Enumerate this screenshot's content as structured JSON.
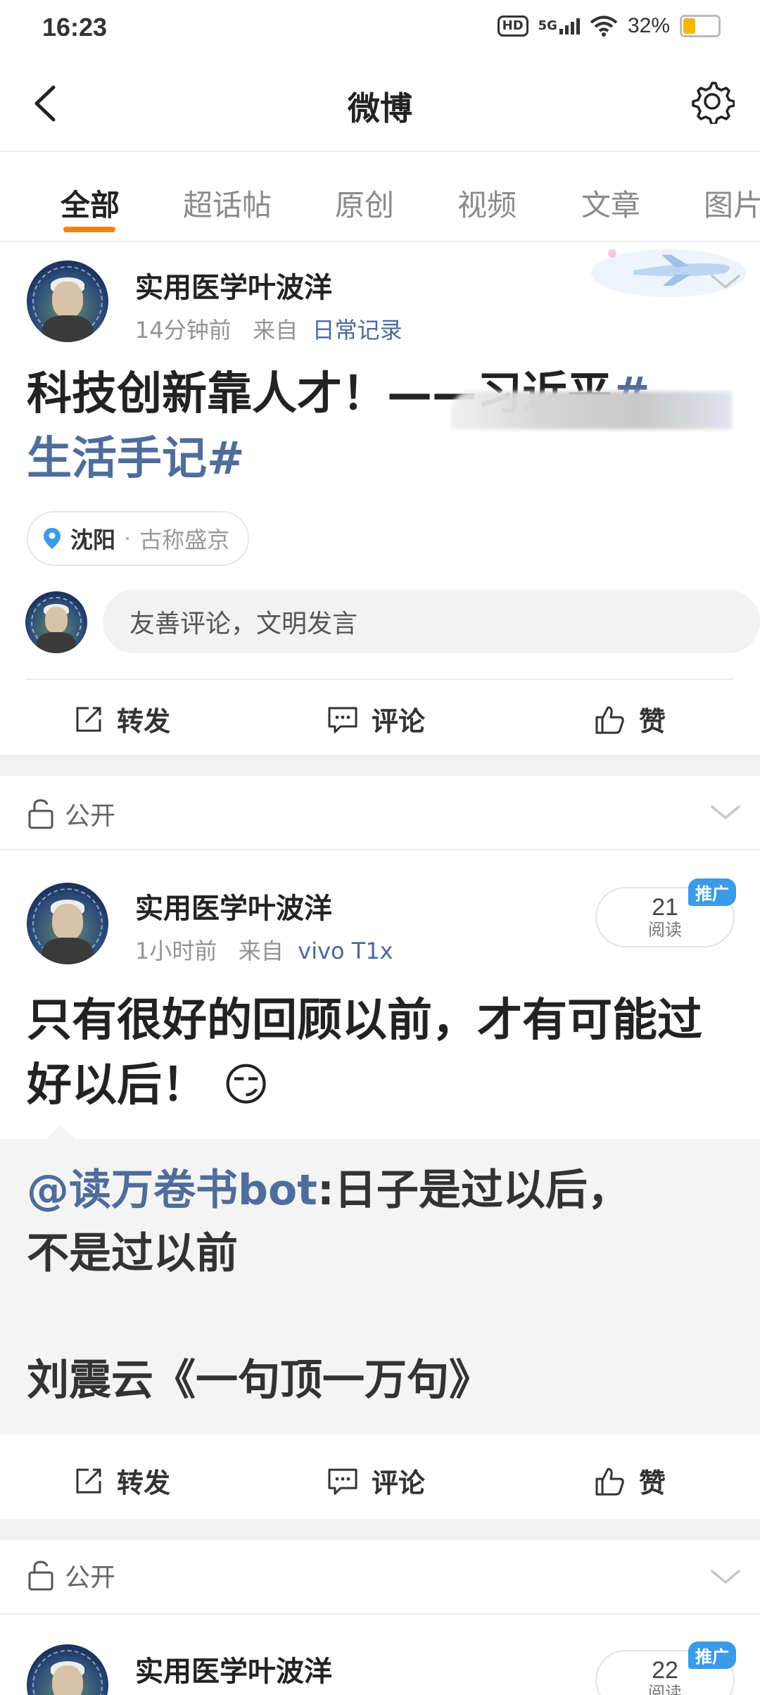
{
  "status_bar": {
    "time": "16:23",
    "hd": "HD",
    "network": "5G",
    "battery": "32%",
    "battery_level": 0.32
  },
  "nav": {
    "title": "微博"
  },
  "tabs": [
    "全部",
    "超话帖",
    "原创",
    "视频",
    "文章",
    "图片"
  ],
  "posts": [
    {
      "author": "实用医学叶波洋",
      "time": "14分钟前",
      "from_label": "来自",
      "source": "日常记录",
      "text": "科技创新靠人才！——习近平",
      "topic_start": "#",
      "topic": "生活手记#",
      "location": {
        "city": "沈阳",
        "dot": "·",
        "desc": "古称盛京"
      },
      "comment_placeholder": "友善评论，文明发言",
      "actions": {
        "repost": "转发",
        "comment": "评论",
        "like": "赞"
      }
    },
    {
      "visibility": "公开",
      "author": "实用医学叶波洋",
      "time": "1小时前",
      "from_label": "来自",
      "source": "vivo T1x",
      "badge": "推广",
      "reads": "21",
      "reads_label": "阅读",
      "text": "只有很好的回顾以前，才有可能过好以后！",
      "emoji": "😏",
      "repost": {
        "mention": "@读万卷书bot",
        "line1": ":日子是过以后，",
        "line2": "不是过以前",
        "line3": "刘震云《一句顶一万句》"
      },
      "actions": {
        "repost": "转发",
        "comment": "评论",
        "like": "赞"
      }
    },
    {
      "visibility": "公开",
      "author": "实用医学叶波洋",
      "badge": "推广",
      "reads": "22",
      "reads_label": "阅读"
    }
  ]
}
